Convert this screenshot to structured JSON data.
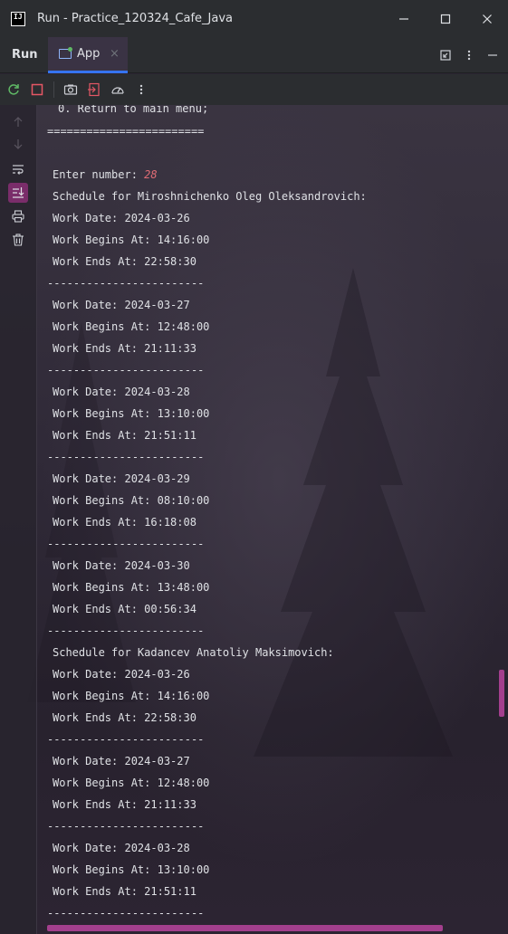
{
  "window": {
    "title": "Run - Practice_120324_Cafe_Java",
    "logo_text": "IJ",
    "minimize_icon": "minimize-icon",
    "maximize_icon": "maximize-icon",
    "close_icon": "close-icon"
  },
  "tool_window": {
    "title": "Run",
    "tab_label": "App",
    "tab_close": "×"
  },
  "accent_colors": {
    "scrollbar": "#a33f8d",
    "selected_button": "#7a2d6a",
    "input_number": "#e06c75"
  },
  "console": {
    "cut_top": "0. Return to main menu;",
    "lines": [
      "========================",
      "",
      "Enter number: ",
      "Schedule for Miroshnichenko Oleg Oleksandrovich:",
      "Work Date: 2024-03-26",
      "Work Begins At: 14:16:00",
      "Work Ends At: 22:58:30",
      "------------------------",
      "Work Date: 2024-03-27",
      "Work Begins At: 12:48:00",
      "Work Ends At: 21:11:33",
      "------------------------",
      "Work Date: 2024-03-28",
      "Work Begins At: 13:10:00",
      "Work Ends At: 21:51:11",
      "------------------------",
      "Work Date: 2024-03-29",
      "Work Begins At: 08:10:00",
      "Work Ends At: 16:18:08",
      "------------------------",
      "Work Date: 2024-03-30",
      "Work Begins At: 13:48:00",
      "Work Ends At: 00:56:34",
      "------------------------",
      "Schedule for Kadancev Anatoliy Maksimovich:",
      "Work Date: 2024-03-26",
      "Work Begins At: 14:16:00",
      "Work Ends At: 22:58:30",
      "------------------------",
      "Work Date: 2024-03-27",
      "Work Begins At: 12:48:00",
      "Work Ends At: 21:11:33",
      "------------------------",
      "Work Date: 2024-03-28",
      "Work Begins At: 13:10:00",
      "Work Ends At: 21:51:11",
      "------------------------"
    ],
    "input_value": "28"
  }
}
